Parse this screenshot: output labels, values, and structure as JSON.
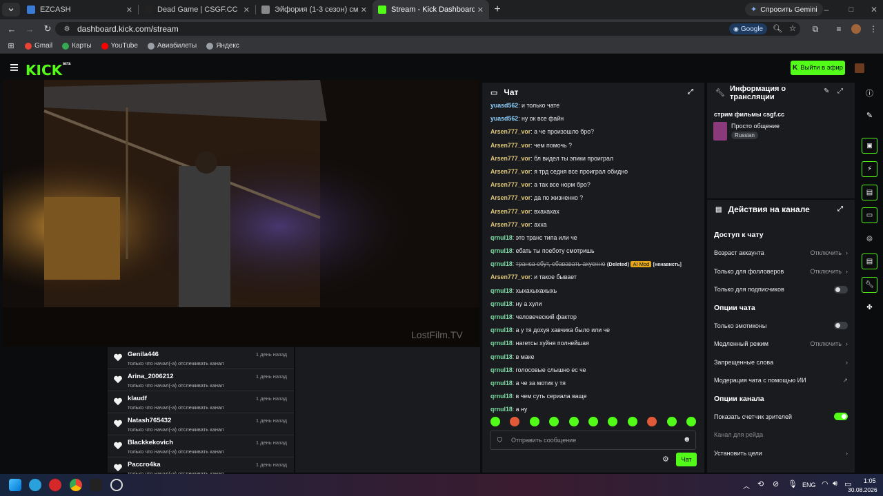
{
  "browser": {
    "tabs": [
      {
        "label": "EZCASH",
        "favicon_color": "#3a7bd5"
      },
      {
        "label": "Dead Game | CSGF.CC",
        "favicon_color": "#222222"
      },
      {
        "label": "Эйфория (1-3 сезон) смот",
        "favicon_color": "#888888"
      },
      {
        "label": "Stream - Kick Dashboard",
        "favicon_color": "#53fc18"
      }
    ],
    "gemini_label": "Спросить Gemini",
    "url": "dashboard.kick.com/stream",
    "google_chip": "Google",
    "bookmarks": [
      {
        "label": "Gmail",
        "color": "#ea4335"
      },
      {
        "label": "Карты",
        "color": "#34a853"
      },
      {
        "label": "YouTube",
        "color": "#ff0000"
      },
      {
        "label": "Авиабилеты",
        "color": "#9aa0a6"
      },
      {
        "label": "Яндекс",
        "color": "#9aa0a6"
      }
    ]
  },
  "kick": {
    "logo": "KICK",
    "logo_beta": "BETA",
    "go_live": "Выйти в эфир",
    "accent": "#53fc18"
  },
  "video": {
    "watermark": "LostFilm.TV"
  },
  "followers": {
    "subtitle": "только что начал(-а) отслеживать канал",
    "time": "1 день назад",
    "items": [
      "Genila446",
      "Arina_2006212",
      "klaudf",
      "Natash765432",
      "Blackkekovich",
      "Paccro4ka"
    ]
  },
  "chat": {
    "title": "Чат",
    "placeholder": "Отправить сообщение",
    "send_label": "Чат",
    "messages": [
      {
        "user": "yuasd562",
        "color": "#8fd3ff",
        "text": "и только чате"
      },
      {
        "user": "yuasd562",
        "color": "#8fd3ff",
        "text": "ну ок все файн"
      },
      {
        "user": "Arsen777_vor",
        "color": "#e0c778",
        "text": "а че произошло бро?"
      },
      {
        "user": "Arsen777_vor",
        "color": "#e0c778",
        "text": "чем помочь ?"
      },
      {
        "user": "Arsen777_vor",
        "color": "#e0c778",
        "text": "бл видел ты эпики проиграл"
      },
      {
        "user": "Arsen777_vor",
        "color": "#e0c778",
        "text": "я трд седня все проиграл обидно"
      },
      {
        "user": "Arsen777_vor",
        "color": "#e0c778",
        "text": "а так все норм бро?"
      },
      {
        "user": "Arsen777_vor",
        "color": "#e0c778",
        "text": "да по жизненно ?"
      },
      {
        "user": "Arsen777_vor",
        "color": "#e0c778",
        "text": "вхахахах"
      },
      {
        "user": "Arsen777_vor",
        "color": "#e0c778",
        "text": "ахха"
      },
      {
        "user": "qrnul18",
        "color": "#7fe0a8",
        "text": "это транс типа или че"
      },
      {
        "user": "qrnul18",
        "color": "#7fe0a8",
        "text": "ебать ты поеботу смотришь"
      },
      {
        "user": "qrnul18",
        "color": "#7fe0a8",
        "text": "транса ебут, ебававать ахуенно",
        "deleted": "(Deleted)",
        "badge": "AI Mod",
        "tag": "[ненависть]"
      },
      {
        "user": "Arsen777_vor",
        "color": "#e0c778",
        "text": "и такое бывает"
      },
      {
        "user": "qrnul18",
        "color": "#7fe0a8",
        "text": "хыхахыхахыхь"
      },
      {
        "user": "qrnul18",
        "color": "#7fe0a8",
        "text": "ну а хули"
      },
      {
        "user": "qrnul18",
        "color": "#7fe0a8",
        "text": "человеческий фактор"
      },
      {
        "user": "qrnul18",
        "color": "#7fe0a8",
        "text": "а у тя дохуя хавчика было или че"
      },
      {
        "user": "qrnul18",
        "color": "#7fe0a8",
        "text": "нагетсы хуйня полнейшая"
      },
      {
        "user": "qrnul18",
        "color": "#7fe0a8",
        "text": "в маке"
      },
      {
        "user": "qrnul18",
        "color": "#7fe0a8",
        "text": "голосовые слышно ес че"
      },
      {
        "user": "qrnul18",
        "color": "#7fe0a8",
        "text": "а че за мотик у тя"
      },
      {
        "user": "qrnul18",
        "color": "#7fe0a8",
        "text": "в чем суть сериала ваще"
      },
      {
        "user": "qrnul18",
        "color": "#7fe0a8",
        "text": "а ну"
      }
    ]
  },
  "info": {
    "title": "Информация о трансляции",
    "stream_title": "стрим фильмы csgf.cc",
    "category": "Просто общение",
    "language": "Russian"
  },
  "actions": {
    "title": "Действия на канале",
    "chat_access": "Доступ к чату",
    "account_age": "Возраст аккаунта",
    "followers_only": "Только для фолловеров",
    "subscribers_only": "Только для подписчиков",
    "off": "Отключить",
    "chat_options": "Опции чата",
    "emotes_only": "Только эмотиконы",
    "slow_mode": "Медленный режим",
    "banned_words": "Запрещенные слова",
    "ai_moderation": "Модерация чата с помощью ИИ",
    "channel_options": "Опции канала",
    "show_viewers": "Показать счетчик зрителей",
    "raid_channel": "Канал для рейда",
    "set_goals": "Установить цели"
  },
  "taskbar": {
    "lang": "ENG",
    "time": "1:05",
    "date": "30.08.2026"
  }
}
